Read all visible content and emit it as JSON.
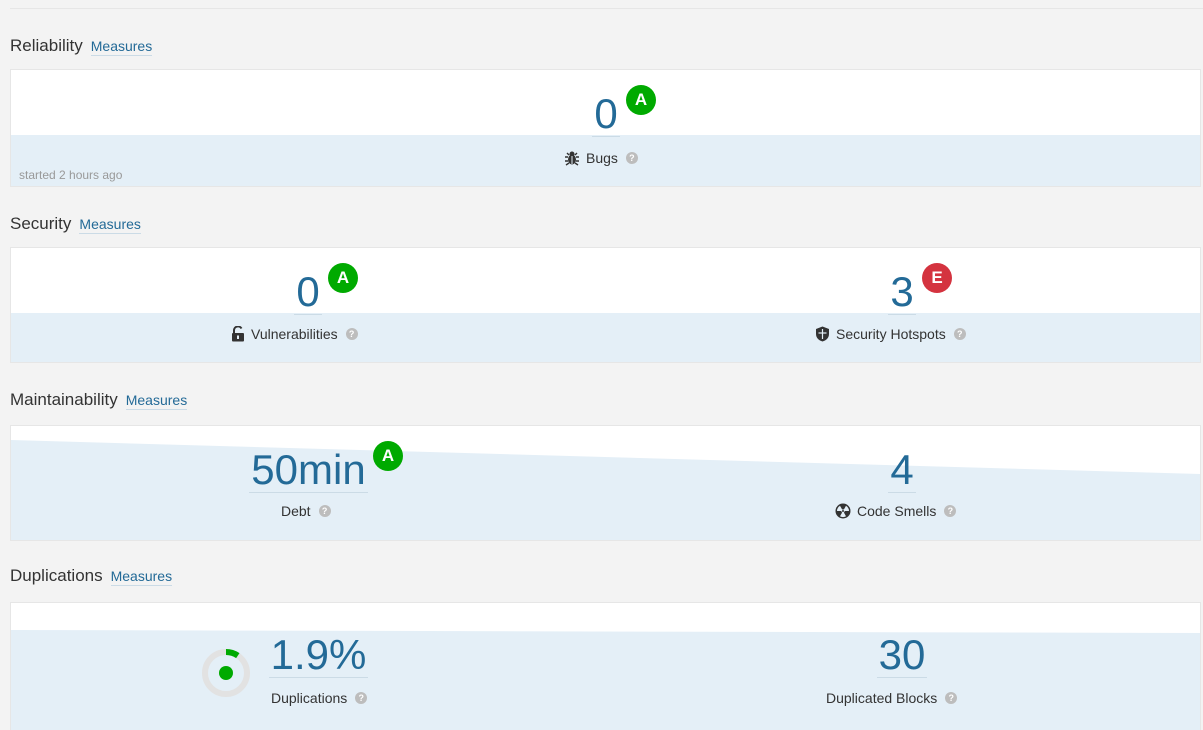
{
  "colors": {
    "link": "#236a97",
    "rating_A": "#00aa00",
    "rating_E": "#d4333f",
    "band": "#e4eff7"
  },
  "reliability": {
    "title": "Reliability",
    "measures_link": "Measures",
    "bugs": {
      "value": "0",
      "rating": "A",
      "label": "Bugs",
      "icon": "bug-icon"
    },
    "started": "started 2 hours ago"
  },
  "security": {
    "title": "Security",
    "measures_link": "Measures",
    "vulnerabilities": {
      "value": "0",
      "rating": "A",
      "label": "Vulnerabilities",
      "icon": "unlock-icon"
    },
    "hotspots": {
      "value": "3",
      "rating": "E",
      "label": "Security Hotspots",
      "icon": "shield-icon"
    }
  },
  "maintainability": {
    "title": "Maintainability",
    "measures_link": "Measures",
    "debt": {
      "value": "50min",
      "rating": "A",
      "label": "Debt"
    },
    "code_smells": {
      "value": "4",
      "label": "Code Smells",
      "icon": "radiation-icon"
    }
  },
  "duplications": {
    "title": "Duplications",
    "measures_link": "Measures",
    "duplications": {
      "value": "1.9%",
      "label": "Duplications",
      "ratio": 0.019
    },
    "duplicated_blocks": {
      "value": "30",
      "label": "Duplicated Blocks"
    }
  },
  "help_glyph": "?"
}
